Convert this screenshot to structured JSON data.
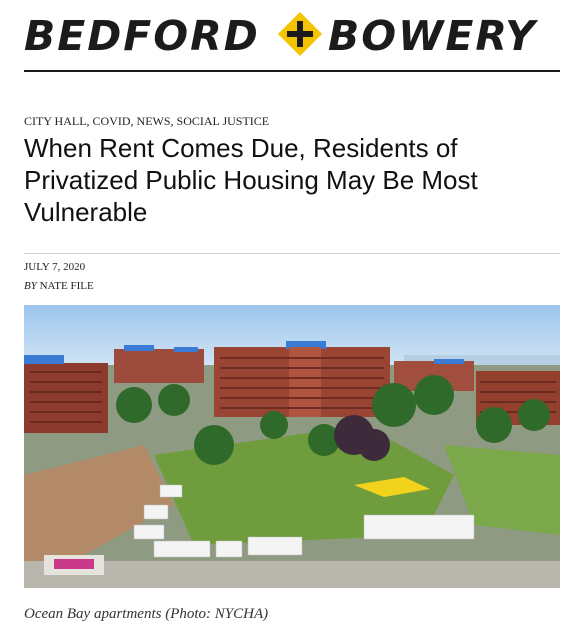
{
  "site": {
    "logo_left": "BEDFORD",
    "logo_right": "BOWERY",
    "logo_symbol": "plus-diamond-icon",
    "accent_color": "#f5c400"
  },
  "article": {
    "categories": [
      "CITY HALL",
      "COVID",
      "NEWS",
      "SOCIAL JUSTICE"
    ],
    "category_separator": ", ",
    "headline": "When Rent Comes Due, Residents of Privatized Public Housing May Be Most Vulnerable",
    "date": "JULY 7, 2020",
    "byline_prefix": "BY",
    "author": "NATE FILE",
    "photo_description_icon": "housing-complex-photo",
    "caption": "Ocean Bay apartments (Photo: NYCHA)"
  }
}
